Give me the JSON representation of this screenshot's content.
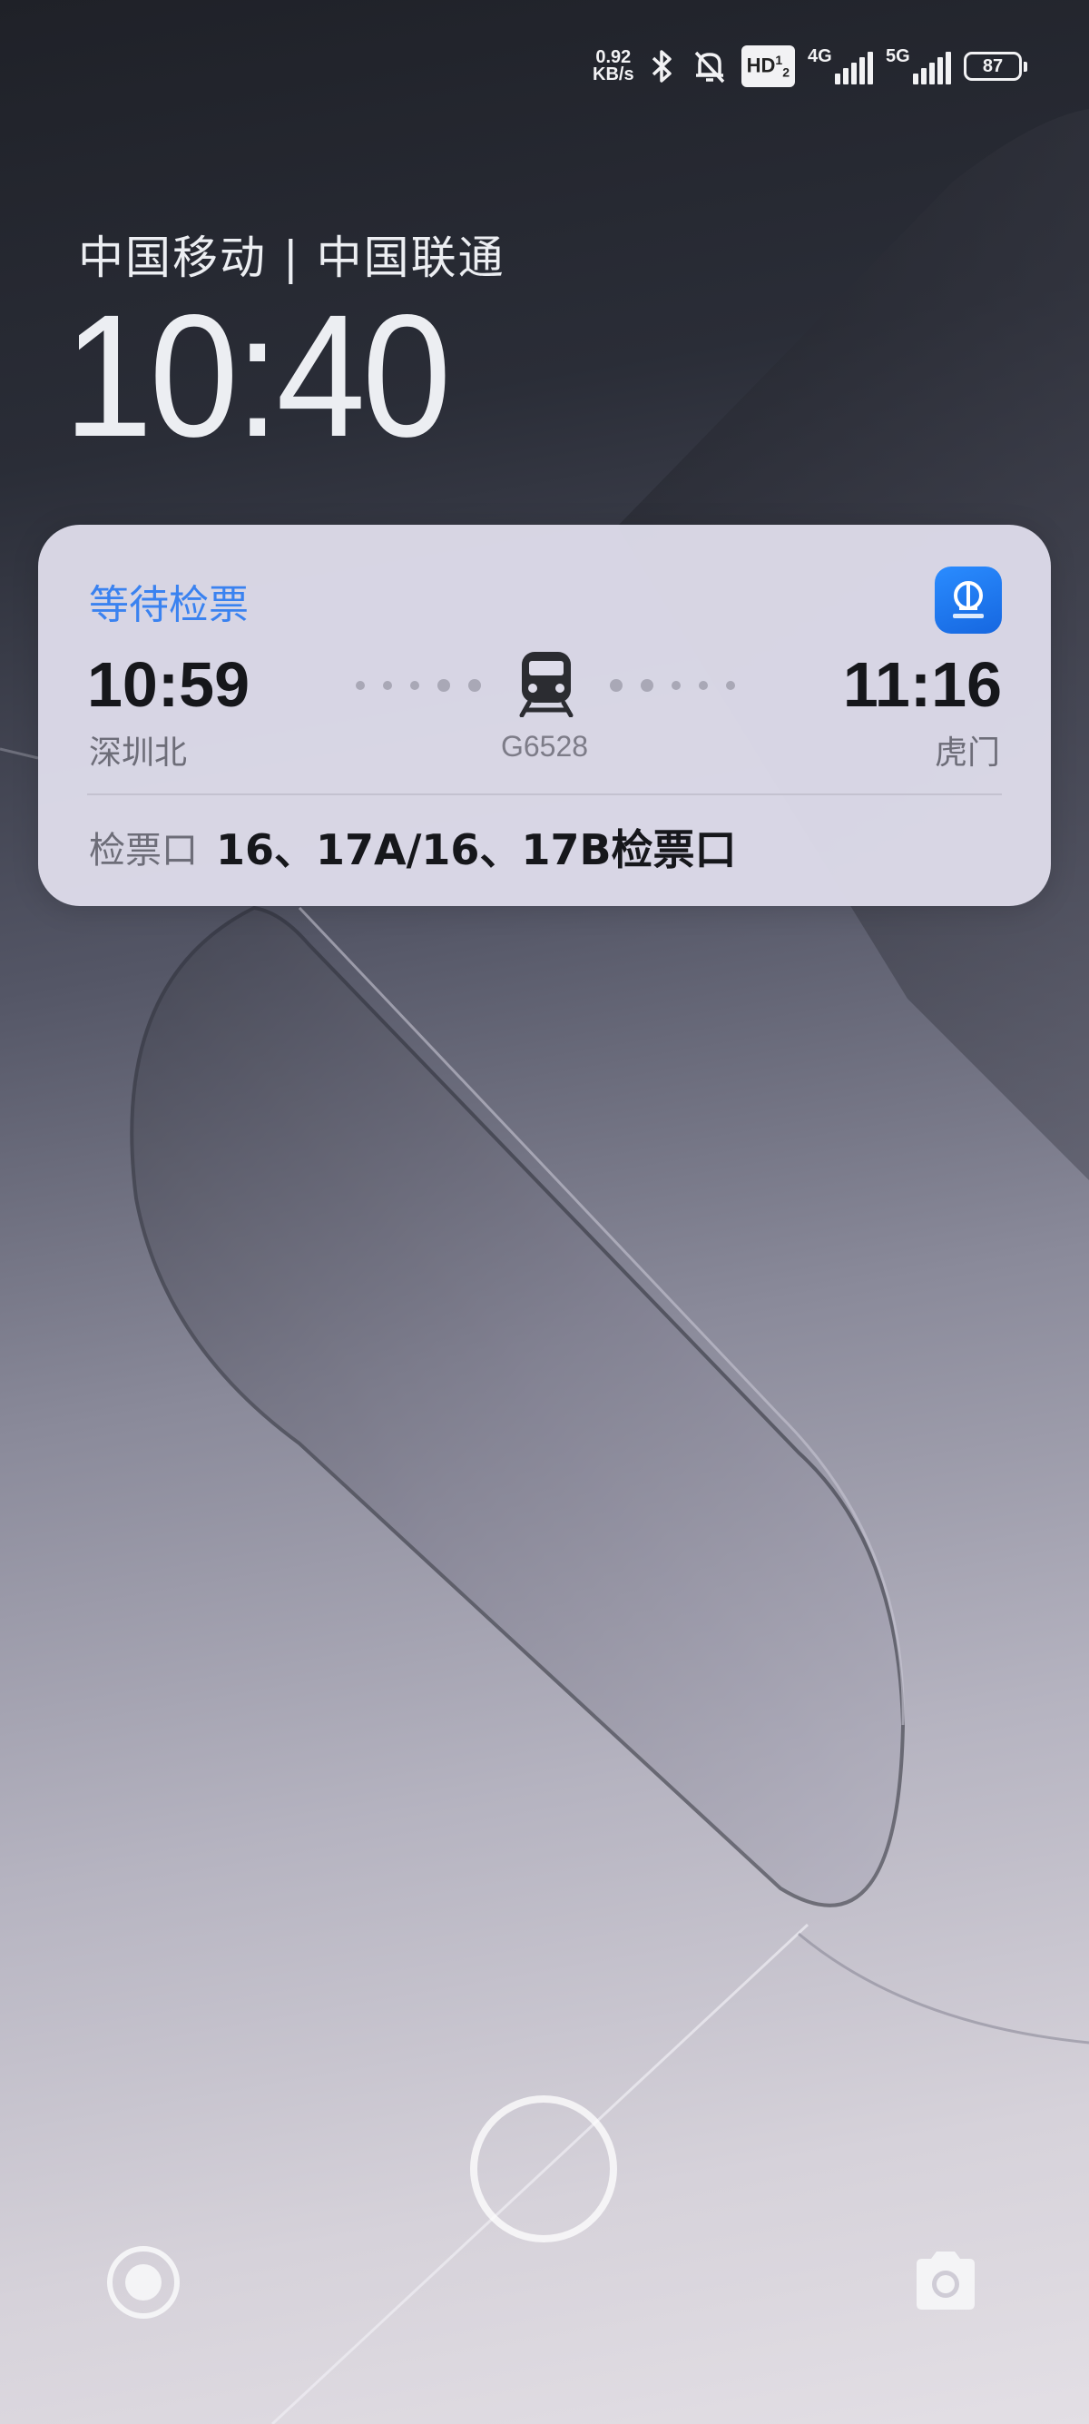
{
  "status_bar": {
    "net_speed_value": "0.92",
    "net_speed_unit": "KB/s",
    "hd_label": "HD",
    "hd_sim": "2",
    "hd_sup": "1",
    "sim1_gen": "4G",
    "sim2_gen": "5G",
    "battery": "87",
    "icons": [
      "bluetooth-icon",
      "mute-bell-icon"
    ]
  },
  "lockscreen": {
    "carrier": "中国移动 | 中国联通",
    "time": "10:40"
  },
  "ticket_card": {
    "status": "等待检票",
    "app_icon": "railway-12306-icon",
    "departure_time": "10:59",
    "departure_station": "深圳北",
    "arrival_time": "11:16",
    "arrival_station": "虎门",
    "train_number": "G6528",
    "gate_label": "检票口",
    "gate_value": "16、17A/16、17B检票口",
    "accent_color": "#3a82f0"
  },
  "bottom_controls": {
    "left_icon": "shortcut-circle-icon",
    "right_icon": "camera-icon",
    "center": "unlock-ring"
  }
}
